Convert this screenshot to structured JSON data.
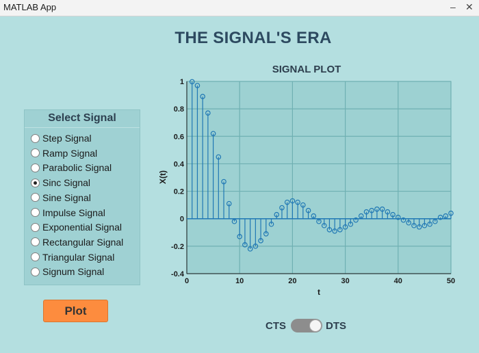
{
  "window": {
    "title": "MATLAB App",
    "minimize_glyph": "–",
    "close_glyph": "✕"
  },
  "app": {
    "heading": "THE SIGNAL'S ERA"
  },
  "signal_panel": {
    "title": "Select Signal",
    "options": [
      {
        "label": "Step Signal",
        "checked": false
      },
      {
        "label": "Ramp Signal",
        "checked": false
      },
      {
        "label": "Parabolic Signal",
        "checked": false
      },
      {
        "label": "Sinc Signal",
        "checked": true
      },
      {
        "label": "Sine Signal",
        "checked": false
      },
      {
        "label": "Impulse Signal",
        "checked": false
      },
      {
        "label": "Exponential Signal",
        "checked": false
      },
      {
        "label": "Rectangular Signal",
        "checked": false
      },
      {
        "label": "Triangular Signal",
        "checked": false
      },
      {
        "label": "Signum Signal",
        "checked": false
      }
    ]
  },
  "plot_button": {
    "label": "Plot"
  },
  "toggle": {
    "left_label": "CTS",
    "right_label": "DTS",
    "state": "DTS"
  },
  "colors": {
    "background": "#b4dfe0",
    "plot_area": "#9dd1d2",
    "stem": "#1f77b4",
    "plot_button": "#fd8c3e"
  },
  "chart_data": {
    "type": "stem",
    "title": "SIGNAL PLOT",
    "xlabel": "t",
    "ylabel": "X(t)",
    "xlim": [
      0,
      50
    ],
    "ylim": [
      -0.4,
      1
    ],
    "xticks": [
      0,
      10,
      20,
      30,
      40,
      50
    ],
    "yticks": [
      -0.4,
      -0.2,
      0,
      0.2,
      0.4,
      0.6,
      0.8,
      1
    ],
    "grid": true,
    "series": [
      {
        "x": [
          1,
          2,
          3,
          4,
          5,
          6,
          7,
          8,
          9,
          10,
          11,
          12,
          13,
          14,
          15,
          16,
          17,
          18,
          19,
          20,
          21,
          22,
          23,
          24,
          25,
          26,
          27,
          28,
          29,
          30,
          31,
          32,
          33,
          34,
          35,
          36,
          37,
          38,
          39,
          40,
          41,
          42,
          43,
          44,
          45,
          46,
          47,
          48,
          49,
          50
        ],
        "y": [
          0.998,
          0.97,
          0.89,
          0.77,
          0.62,
          0.45,
          0.27,
          0.11,
          -0.02,
          -0.13,
          -0.19,
          -0.22,
          -0.2,
          -0.16,
          -0.11,
          -0.04,
          0.03,
          0.08,
          0.12,
          0.13,
          0.12,
          0.1,
          0.06,
          0.02,
          -0.02,
          -0.05,
          -0.08,
          -0.09,
          -0.08,
          -0.06,
          -0.04,
          -0.01,
          0.02,
          0.05,
          0.06,
          0.07,
          0.07,
          0.05,
          0.03,
          0.01,
          -0.01,
          -0.03,
          -0.05,
          -0.06,
          -0.05,
          -0.04,
          -0.02,
          0.01,
          0.02,
          0.04
        ]
      }
    ]
  }
}
